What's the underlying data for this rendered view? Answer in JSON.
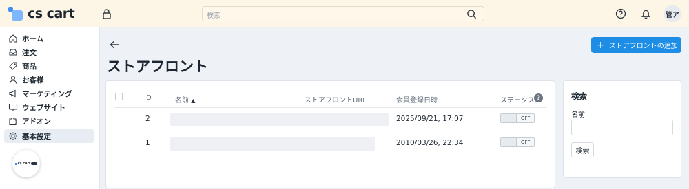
{
  "app": {
    "logo_text": "cs cart",
    "widget_logo_text": "cs cart"
  },
  "header": {
    "search_placeholder": "検索",
    "avatar_text": "管ア"
  },
  "sidebar": {
    "items": [
      {
        "label": "ホーム",
        "icon": "home-icon"
      },
      {
        "label": "注文",
        "icon": "inbox-icon"
      },
      {
        "label": "商品",
        "icon": "tag-icon"
      },
      {
        "label": "お客様",
        "icon": "user-icon"
      },
      {
        "label": "マーケティング",
        "icon": "megaphone-icon"
      },
      {
        "label": "ウェブサイト",
        "icon": "monitor-icon"
      },
      {
        "label": "アドオン",
        "icon": "puzzle-icon"
      },
      {
        "label": "基本設定",
        "icon": "gear-icon",
        "active": true
      }
    ]
  },
  "page": {
    "title": "ストアフロント",
    "add_button_label": "ストアフロントの追加"
  },
  "table": {
    "columns": {
      "id": "ID",
      "name": "名前",
      "url": "ストアフロントURL",
      "registered": "会員登録日時",
      "status": "ステータス"
    },
    "status_help": "?",
    "rows": [
      {
        "id": "2",
        "registered": "2025/09/21, 17:07",
        "status": "OFF"
      },
      {
        "id": "1",
        "registered": "2010/03/26, 22:34",
        "status": "OFF"
      }
    ]
  },
  "search_panel": {
    "title": "検索",
    "name_label": "名前",
    "button_label": "検索"
  },
  "colors": {
    "accent": "#1e8de6",
    "header_bg": "#fdf6e6",
    "page_bg": "#eef1f6"
  }
}
